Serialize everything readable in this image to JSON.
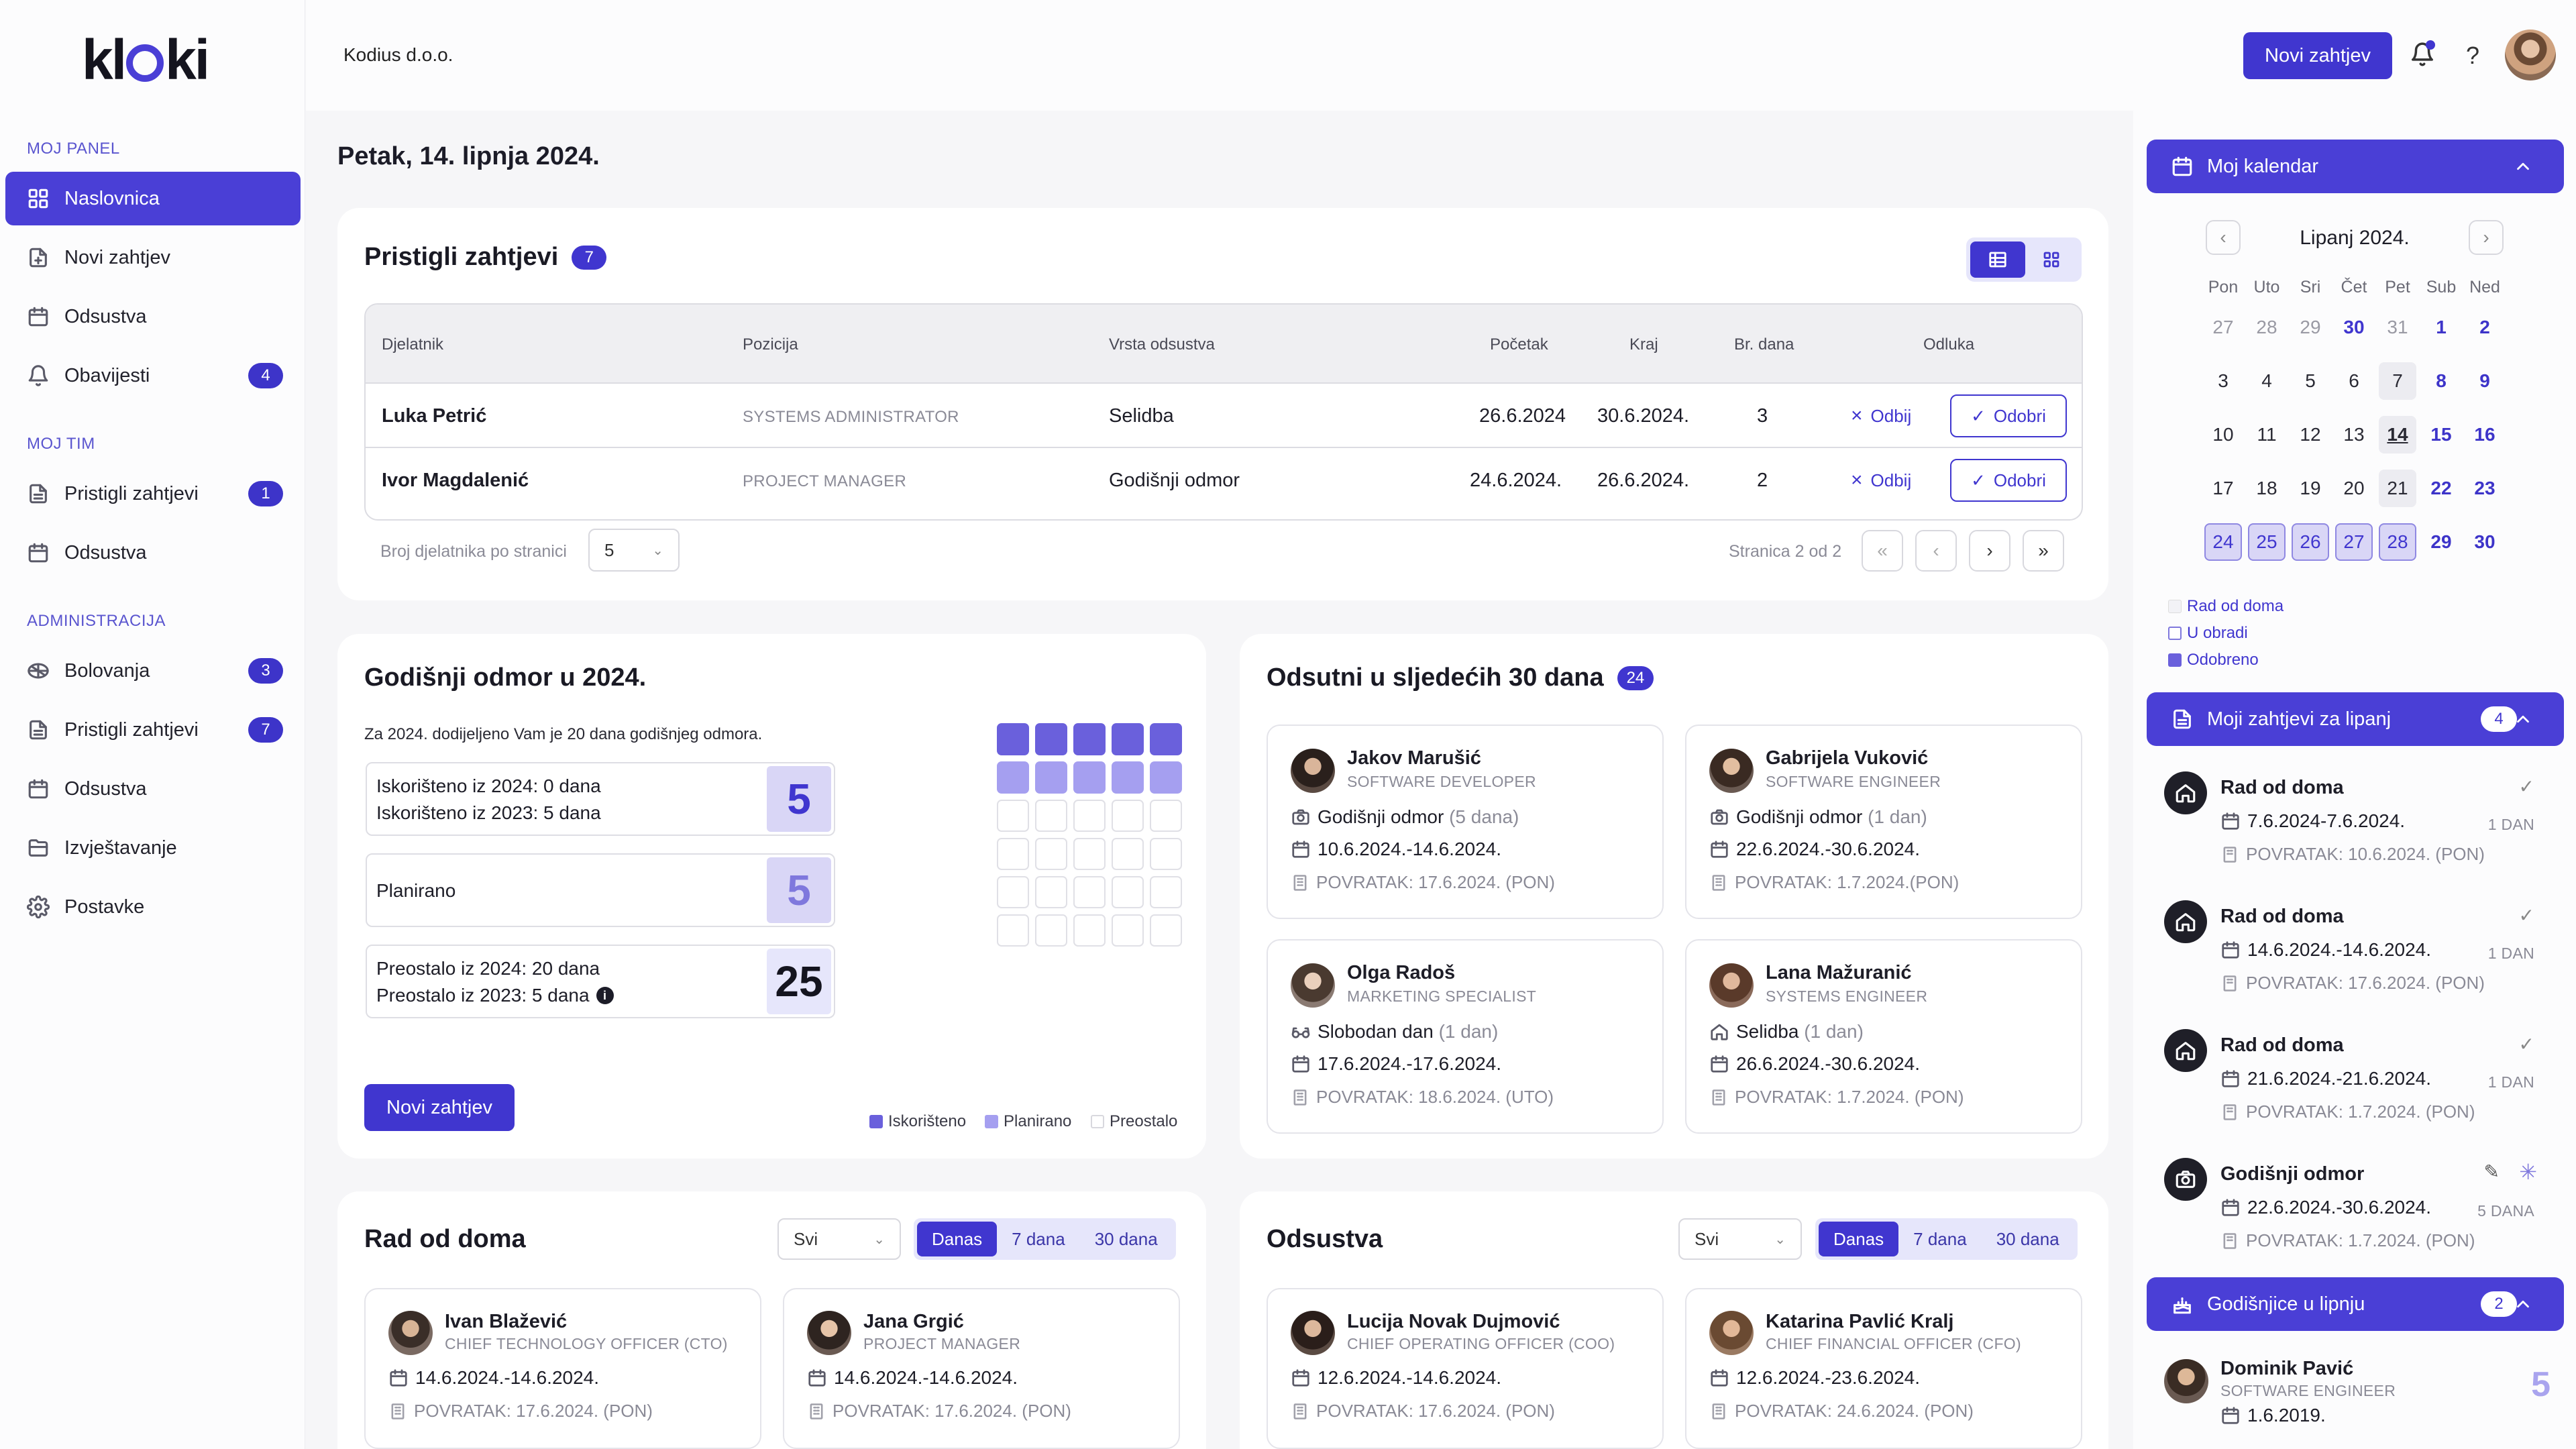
{
  "app": {
    "logo": "kloki",
    "company": "Kodius d.o.o.",
    "new_request": "Novi zahtjev"
  },
  "colors": {
    "accent": "#4036cf",
    "accent_light": "#9a93e6",
    "accent_pale": "#d9d6f6"
  },
  "sidebar": {
    "sections": [
      "MOJ PANEL",
      "MOJ TIM",
      "ADMINISTRACIJA"
    ],
    "items": [
      {
        "label": "Naslovnica",
        "icon": "dashboard-icon"
      },
      {
        "label": "Novi zahtjev",
        "icon": "new-request-icon"
      },
      {
        "label": "Odsustva",
        "icon": "calendar-icon"
      },
      {
        "label": "Obavijesti",
        "icon": "bell-icon",
        "badge": "4"
      },
      {
        "label": "Pristigli zahtjevi",
        "icon": "document-icon",
        "badge": "1"
      },
      {
        "label": "Odsustva",
        "icon": "calendar-icon"
      },
      {
        "label": "Bolovanja",
        "icon": "sick-icon",
        "badge": "3"
      },
      {
        "label": "Pristigli zahtjevi",
        "icon": "document-icon",
        "badge": "7"
      },
      {
        "label": "Odsustva",
        "icon": "calendar-icon"
      },
      {
        "label": "Izvještavanje",
        "icon": "folder-icon"
      },
      {
        "label": "Postavke",
        "icon": "gear-icon"
      }
    ]
  },
  "date_heading": "Petak, 14. lipnja 2024.",
  "incoming": {
    "title": "Pristigli zahtjevi",
    "count": "7",
    "headers": [
      "Djelatnik",
      "Pozicija",
      "Vrsta odsustva",
      "Početak",
      "Kraj",
      "Br. dana",
      "Odluka"
    ],
    "rows": [
      {
        "name": "Luka Petrić",
        "position": "SYSTEMS ADMINISTRATOR",
        "type": "Selidba",
        "start": "26.6.2024",
        "end": "30.6.2024.",
        "days": "3"
      },
      {
        "name": "Ivor Magdalenić",
        "position": "PROJECT MANAGER",
        "type": "Godišnji odmor",
        "start": "24.6.2024.",
        "end": "26.6.2024.",
        "days": "2"
      }
    ],
    "reject": "Odbij",
    "approve": "Odobri",
    "per_page_label": "Broj djelatnika po stranici",
    "per_page": "5",
    "page_info": "Stranica 2 od 2"
  },
  "vacation": {
    "title": "Godišnji odmor u 2024.",
    "intro": "Za 2024. dodijeljeno Vam je 20 dana godišnjeg odmora.",
    "used_2024": "Iskorišteno iz 2024: 0 dana",
    "used_2023": "Iskorišteno iz 2023: 5 dana",
    "used": "5",
    "planned_label": "Planirano",
    "planned": "5",
    "left_2024": "Preostalo iz 2024: 20 dana",
    "left_2023": "Preostalo iz 2023: 5 dana",
    "left": "25",
    "button": "Novi zahtjev",
    "legend": [
      "Iskorišteno",
      "Planirano",
      "Preostalo"
    ],
    "grid": {
      "used": 5,
      "planned": 5,
      "total": 30
    }
  },
  "absent30": {
    "title": "Odsutni u sljedećih 30 dana",
    "count": "24",
    "people": [
      {
        "name": "Jakov Marušić",
        "role": "SOFTWARE DEVELOPER",
        "type": "Godišnji odmor",
        "days": "(5 dana)",
        "dates": "10.6.2024.-14.6.2024.",
        "ret": "POVRATAK: 17.6.2024. (PON)",
        "icon": "camera-icon"
      },
      {
        "name": "Gabrijela Vuković",
        "role": "SOFTWARE ENGINEER",
        "type": "Godišnji odmor",
        "days": "(1 dan)",
        "dates": "22.6.2024.-30.6.2024.",
        "ret": "POVRATAK: 1.7.2024.(PON)",
        "icon": "camera-icon"
      },
      {
        "name": "Olga Radoš",
        "role": "MARKETING SPECIALIST",
        "type": "Slobodan dan",
        "days": "(1 dan)",
        "dates": "17.6.2024.-17.6.2024.",
        "ret": "POVRATAK: 18.6.2024. (UTO)",
        "icon": "glasses-icon"
      },
      {
        "name": "Lana Mažuranić",
        "role": "SYSTEMS ENGINEER",
        "type": "Selidba",
        "days": "(1 dan)",
        "dates": "26.6.2024.-30.6.2024.",
        "ret": "POVRATAK: 1.7.2024. (PON)",
        "icon": "house-icon"
      }
    ]
  },
  "wfh": {
    "title": "Rad od doma",
    "filter": "Svi",
    "tabs": [
      "Danas",
      "7 dana",
      "30 dana"
    ],
    "people": [
      {
        "name": "Ivan Blažević",
        "role": "CHIEF TECHNOLOGY OFFICER (CTO)",
        "dates": "14.6.2024.-14.6.2024.",
        "ret": "POVRATAK: 17.6.2024. (PON)"
      },
      {
        "name": "Jana Grgić",
        "role": "PROJECT MANAGER",
        "dates": "14.6.2024.-14.6.2024.",
        "ret": "POVRATAK: 17.6.2024. (PON)"
      }
    ]
  },
  "absences": {
    "title": "Odsustva",
    "filter": "Svi",
    "tabs": [
      "Danas",
      "7 dana",
      "30 dana"
    ],
    "people": [
      {
        "name": "Lucija Novak Dujmović",
        "role": "CHIEF OPERATING OFFICER (COO)",
        "dates": "12.6.2024.-14.6.2024.",
        "ret": "POVRATAK: 17.6.2024. (PON)"
      },
      {
        "name": "Katarina Pavlić Kralj",
        "role": "CHIEF FINANCIAL OFFICER (CFO)",
        "dates": "12.6.2024.-23.6.2024.",
        "ret": "POVRATAK: 24.6.2024. (PON)"
      }
    ]
  },
  "calendar": {
    "title": "Moj kalendar",
    "month": "Lipanj 2024.",
    "weekdays": [
      "Pon",
      "Uto",
      "Sri",
      "Čet",
      "Pet",
      "Sub",
      "Ned"
    ],
    "weeks": [
      [
        "27",
        "28",
        "29",
        "30",
        "31",
        "1",
        "2"
      ],
      [
        "3",
        "4",
        "5",
        "6",
        "7",
        "8",
        "9"
      ],
      [
        "10",
        "11",
        "12",
        "13",
        "14",
        "15",
        "16"
      ],
      [
        "17",
        "18",
        "19",
        "20",
        "21",
        "22",
        "23"
      ],
      [
        "24",
        "25",
        "26",
        "27",
        "28",
        "29",
        "30"
      ]
    ],
    "legend": [
      "Rad od doma",
      "U obradi",
      "Odobreno"
    ]
  },
  "my_requests": {
    "title": "Moji zahtjevi za lipanj",
    "count": "4",
    "items": [
      {
        "title": "Rad od doma",
        "dates": "7.6.2024-7.6.2024.",
        "days": "1 DAN",
        "ret": "POVRATAK: 10.6.2024. (PON)",
        "icon": "house-icon"
      },
      {
        "title": "Rad od doma",
        "dates": "14.6.2024.-14.6.2024.",
        "days": "1 DAN",
        "ret": "POVRATAK: 17.6.2024. (PON)",
        "icon": "house-icon"
      },
      {
        "title": "Rad od doma",
        "dates": "21.6.2024.-21.6.2024.",
        "days": "1 DAN",
        "ret": "POVRATAK: 1.7.2024. (PON)",
        "icon": "house-icon"
      },
      {
        "title": "Godišnji odmor",
        "dates": "22.6.2024.-30.6.2024.",
        "days": "5 DANA",
        "ret": "POVRATAK: 1.7.2024. (PON)",
        "icon": "camera-icon"
      }
    ]
  },
  "anniversaries": {
    "title": "Godišnjice u lipnju",
    "count": "2",
    "items": [
      {
        "name": "Dominik Pavić",
        "role": "SOFTWARE ENGINEER",
        "date": "1.6.2019.",
        "years": "5"
      }
    ]
  }
}
